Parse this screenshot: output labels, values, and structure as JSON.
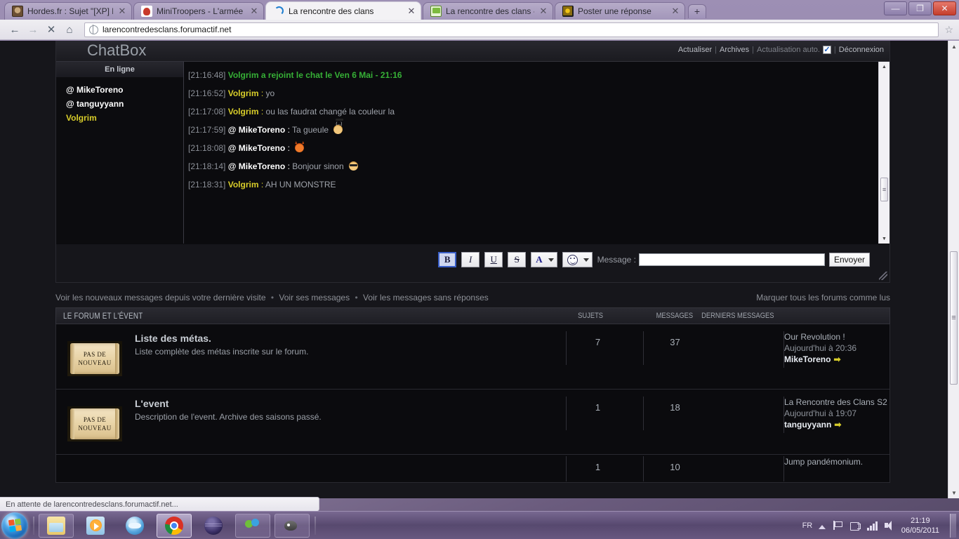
{
  "browser": {
    "tabs": [
      {
        "title": "Hordes.fr : Sujet \"[XP] Le ...",
        "favicon": "hordes-icon",
        "active": false
      },
      {
        "title": "MiniTroopers - L'armée d...",
        "favicon": "minitroopers-icon",
        "active": false
      },
      {
        "title": "La rencontre des clans",
        "favicon": "loading-spinner-icon",
        "active": true
      },
      {
        "title": "La rencontre des clans - ...",
        "favicon": "chat-bubble-icon",
        "active": false
      },
      {
        "title": "Poster une réponse",
        "favicon": "poster-icon",
        "active": false
      }
    ],
    "new_tab_label": "+",
    "close_label": "✕",
    "window_buttons": {
      "minimize": "—",
      "maximize": "❐",
      "close": "✕"
    },
    "nav": {
      "back": "←",
      "forward": "→",
      "stop": "✕",
      "home": "⌂",
      "bookmark": "☆"
    },
    "url": "larencontredesclans.forumactif.net",
    "status": "En attente de larencontredesclans.forumactif.net..."
  },
  "chatbox": {
    "title": "ChatBox",
    "links": {
      "refresh": "Actualiser",
      "archives": "Archives",
      "auto_refresh": "Actualisation auto.",
      "auto_refresh_checked": true,
      "logout": "Déconnexion",
      "separator": "|"
    },
    "online_header": "En ligne",
    "online_users": [
      {
        "name": "@ MikeToreno",
        "self": false
      },
      {
        "name": "@ tanguyyann",
        "self": false
      },
      {
        "name": "Volgrim",
        "self": true
      }
    ],
    "messages": [
      {
        "time": "[21:16:48]",
        "type": "join",
        "text": "Volgrim a rejoint le chat le Ven 6 Mai - 21:16"
      },
      {
        "time": "[21:16:52]",
        "nick": "Volgrim",
        "self": true,
        "body": "yo",
        "emoji": ""
      },
      {
        "time": "[21:17:08]",
        "nick": "Volgrim",
        "self": true,
        "body": "ou las faudrat changé la couleur la",
        "emoji": ""
      },
      {
        "time": "[21:17:59]",
        "nick": "@ MikeToreno",
        "self": false,
        "body": "Ta gueule",
        "emoji": "shades-bubble-emoji"
      },
      {
        "time": "[21:18:08]",
        "nick": "@ MikeToreno",
        "self": false,
        "body": "",
        "emoji": "devil-emoji"
      },
      {
        "time": "[21:18:14]",
        "nick": "@ MikeToreno",
        "self": false,
        "body": "Bonjour sinon",
        "emoji": "shades-emoji"
      },
      {
        "time": "[21:18:31]",
        "nick": "Volgrim",
        "self": true,
        "body": "AH UN MONSTRE",
        "emoji": ""
      }
    ],
    "toolbar": {
      "bold": "B",
      "italic": "I",
      "underline": "U",
      "strike": "S",
      "font_color": "A",
      "message_label": "Message :",
      "message_value": "",
      "send": "Envoyer"
    }
  },
  "quicklinks": {
    "new_messages": "Voir les nouveaux messages depuis votre dernière visite",
    "own_messages": "Voir ses messages",
    "unanswered": "Voir les messages sans réponses",
    "bullet": "•",
    "mark_read": "Marquer tous les forums comme lus"
  },
  "forum": {
    "category": "LE FORUM ET L'ÉVENT",
    "columns": {
      "topics": "SUJETS",
      "posts": "MESSAGES",
      "last": "DERNIERS MESSAGES"
    },
    "icon_text_line1": "PAS DE",
    "icon_text_line2": "NOUVEAU",
    "rows": [
      {
        "title": "Liste des métas.",
        "desc": "Liste complète des métas inscrite sur le forum.",
        "topics": "7",
        "posts": "37",
        "last_title": "Our Revolution !",
        "last_date": "Aujourd'hui à 20:36",
        "last_user": "MikeToreno",
        "arrow": "➡"
      },
      {
        "title": "L'event",
        "desc": "Description de l'event. Archive des saisons passé.",
        "topics": "1",
        "posts": "18",
        "last_title": "La Rencontre des Clans S2",
        "last_date": "Aujourd'hui à 19:07",
        "last_user": "tanguyyann",
        "arrow": "➡"
      },
      {
        "title": "",
        "desc": "",
        "topics": "1",
        "posts": "10",
        "last_title": "Jump pandémonium.",
        "last_date": "",
        "last_user": "",
        "arrow": ""
      }
    ]
  },
  "taskbar": {
    "start_label": "Start",
    "apps": [
      {
        "name": "explorer-icon",
        "active": false
      },
      {
        "name": "media-player-icon",
        "active": false
      },
      {
        "name": "openoffice-icon",
        "active": false
      },
      {
        "name": "chrome-icon",
        "active": true
      },
      {
        "name": "sphere-app-icon",
        "active": false
      },
      {
        "name": "messenger-icon",
        "active": false
      },
      {
        "name": "gimp-icon",
        "active": false
      }
    ],
    "tray": {
      "language": "FR",
      "time": "21:19",
      "date": "06/05/2011"
    }
  }
}
